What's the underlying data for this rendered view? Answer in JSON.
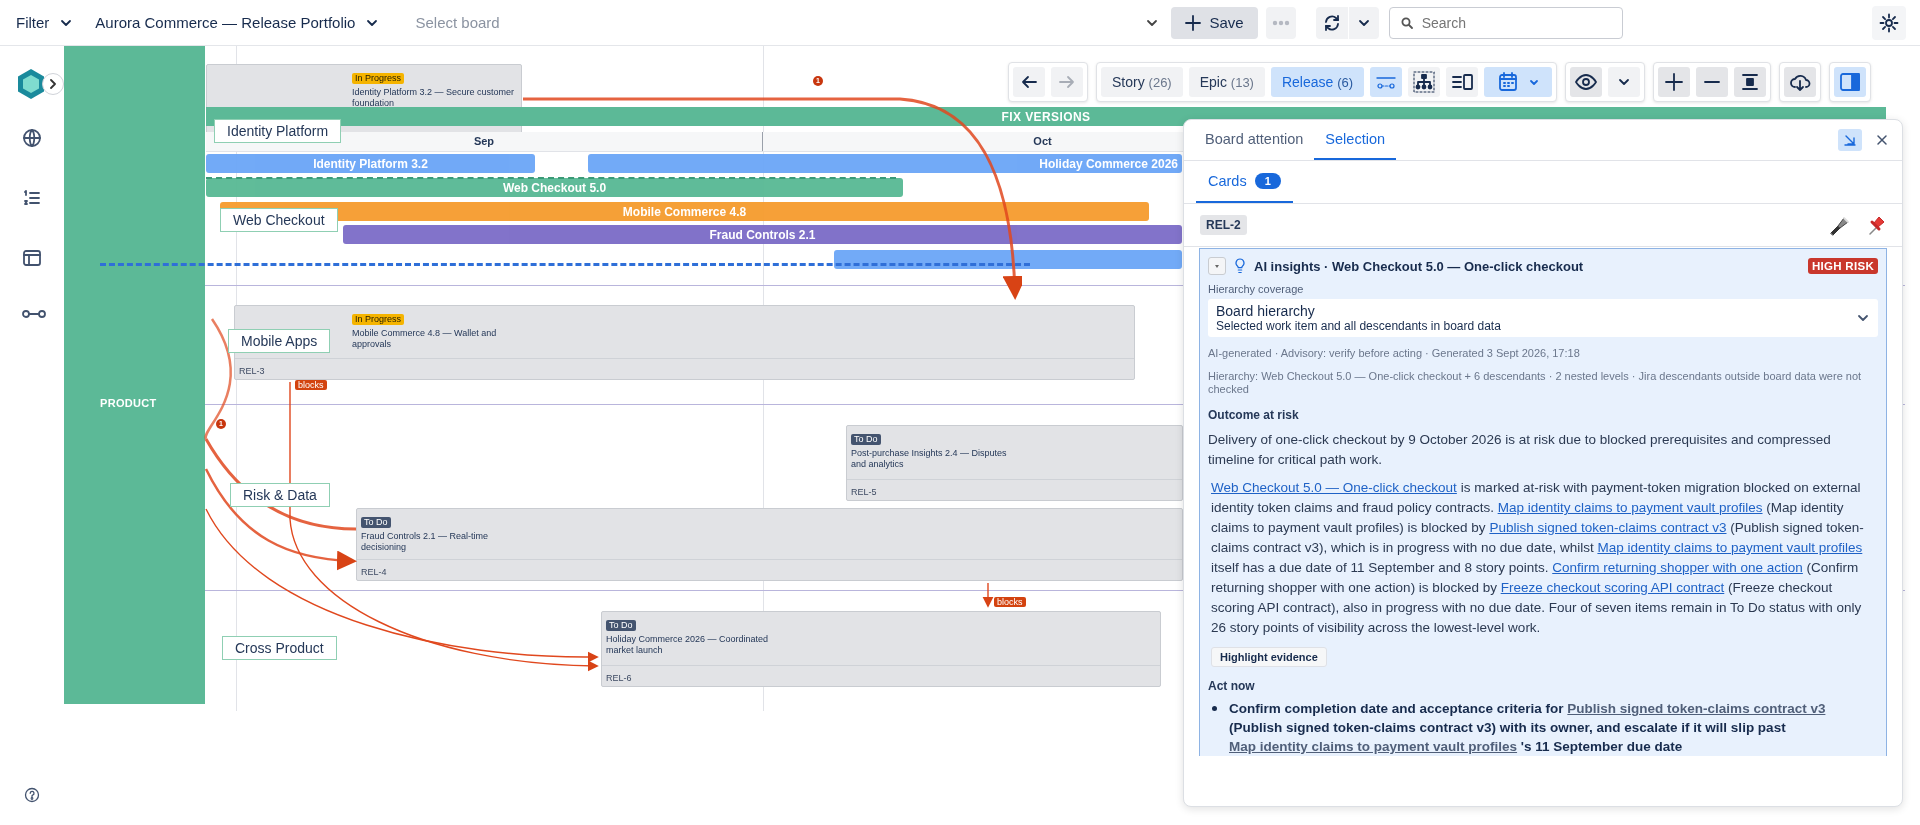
{
  "top_bar": {
    "filter_label": "Filter",
    "board_name": "Aurora Commerce — Release Portfolio",
    "board_placeholder": "Select board",
    "save_label": "Save",
    "search_placeholder": "Search"
  },
  "toolbar": {
    "nav": [
      {
        "kind": "back",
        "disabled": false
      },
      {
        "kind": "forward",
        "disabled": true
      }
    ],
    "types": [
      {
        "label": "Story",
        "count": "(26)",
        "selected": false
      },
      {
        "label": "Epic",
        "count": "(13)",
        "selected": false
      },
      {
        "label": "Release",
        "count": "(6)",
        "selected": true
      }
    ],
    "view_buttons": [
      {
        "kind": "dependencies",
        "selected": true
      },
      {
        "kind": "hierarchy",
        "selected": false
      },
      {
        "kind": "list",
        "selected": false
      },
      {
        "kind": "calendar",
        "selected": true
      }
    ],
    "panel_toggle": {
      "selected": true
    }
  },
  "board": {
    "group_label": "PRODUCT",
    "fix_versions_label": "FIX VERSIONS",
    "months": [
      "Sep",
      "Oct"
    ],
    "lanes": [
      "Identity Platform",
      "Web Checkout",
      "Mobile Apps",
      "Risk & Data",
      "Cross Product"
    ],
    "releases": [
      {
        "name": "Identity Platform 3.2",
        "color": "#6aa5f7"
      },
      {
        "name": "Holiday Commerce 2026",
        "color": "#6aa5f7"
      },
      {
        "name": "Web Checkout 5.0",
        "color": "#57b894"
      },
      {
        "name": "Mobile Commerce 4.8",
        "color": "#f59b2d"
      },
      {
        "name": "Fraud Controls 2.1",
        "color": "#7b6bc7"
      },
      {
        "color": "#6aa5f7"
      }
    ],
    "cards": [
      {
        "status": "In Progress",
        "color": "#f5b400",
        "title": "Identity Platform 3.2 — Secure customer foundation"
      },
      {
        "status": "In Progress",
        "color": "#f5b400",
        "title": "Mobile Commerce 4.8 — Wallet and approvals",
        "key": "REL-3"
      },
      {
        "status": "To Do",
        "color": "#44546f",
        "title": "Post-purchase Insights 2.4 — Disputes and analytics",
        "key": "REL-5"
      },
      {
        "status": "To Do",
        "color": "#44546f",
        "title": "Fraud Controls 2.1 — Real-time decisioning",
        "key": "REL-4"
      },
      {
        "status": "To Do",
        "color": "#44546f",
        "title": "Holiday Commerce 2026 — Coordinated market launch",
        "key": "REL-6"
      }
    ],
    "dependency_badges": [
      "1",
      "1"
    ],
    "blocks_labels": [
      "blocks",
      "blocks"
    ]
  },
  "panel": {
    "tabs": [
      {
        "label": "Board attention",
        "selected": false
      },
      {
        "label": "Selection",
        "selected": true
      }
    ],
    "subtabs": [
      {
        "label": "Cards",
        "count": "1",
        "selected": true
      }
    ],
    "chip": "REL-2",
    "insight": {
      "title": "AI insights ·",
      "subject": "Web Checkout 5.0 — One-click checkout",
      "risk": "HIGH RISK",
      "coverage_label": "Hierarchy coverage",
      "coverage": {
        "title": "Board hierarchy",
        "subtitle": "Selected work item and all descendants in board data"
      },
      "meta": "AI-generated · Advisory: verify before acting · Generated 3 Sept 2026, 17:18",
      "hierarchy": "Hierarchy:  Web Checkout 5.0 — One-click checkout  + 6 descendants · 2 nested levels · Jira descendants outside board data were not checked",
      "outcome_heading": "Outcome at risk",
      "outcome": "Delivery of one-click checkout by 9 October 2026 is at risk due to blocked prerequisites and compressed timeline for critical path work.",
      "evidence": [
        {
          "text": "Web Checkout 5.0 — One-click checkout",
          "link": true
        },
        {
          "text": " is marked at-risk with payment-token migration blocked on external identity token claims and fraud policy contracts. ",
          "link": false
        },
        {
          "text": "Map identity claims to payment vault profiles",
          "link": true
        },
        {
          "text": " (Map identity claims to payment vault profiles) is blocked by ",
          "link": false
        },
        {
          "text": "Publish signed token-claims contract v3",
          "link": true
        },
        {
          "text": " (Publish signed token-claims contract v3), which is in progress with no due date, whilst ",
          "link": false
        },
        {
          "text": "Map identity claims to payment vault profiles",
          "link": true
        },
        {
          "text": " itself has a due date of 11 September and 8 story points. ",
          "link": false
        },
        {
          "text": "Confirm returning shopper with one action",
          "link": true
        },
        {
          "text": " (Confirm returning shopper with one action) is blocked by ",
          "link": false
        },
        {
          "text": "Freeze checkout scoring API contract",
          "link": true
        },
        {
          "text": " (Freeze checkout scoring API contract), also in progress with no due date. Four of seven items remain in To Do status with only 26 story points of visibility across the lowest-level work.",
          "link": false
        }
      ],
      "evidence_button": "Highlight evidence",
      "act_heading": "Act now",
      "actions": [
        [
          {
            "text": "Confirm completion date and acceptance criteria for ",
            "link": false
          },
          {
            "text": "Publish signed token-claims contract v3",
            "link": true
          },
          {
            "text": " (Publish signed token-claims contract v3) with its owner, and escalate if it will slip past ",
            "link": false
          },
          {
            "text": "Map identity claims to payment vault profiles",
            "link": true
          },
          {
            "text": " 's 11 September due date",
            "link": false
          }
        ]
      ]
    }
  }
}
